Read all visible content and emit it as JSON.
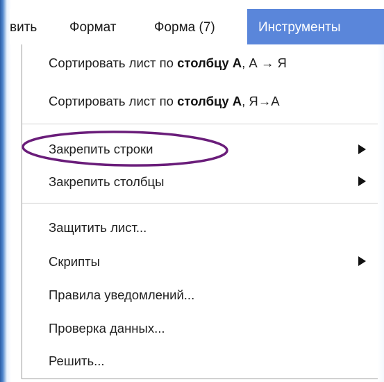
{
  "menubar": {
    "items": [
      {
        "label": "вить"
      },
      {
        "label": "Формат"
      },
      {
        "label": "Форма (7)"
      },
      {
        "label": "Инструменты"
      }
    ]
  },
  "menu": {
    "sort_az": {
      "prefix": "Сортировать лист по ",
      "bold": "столбцу А",
      "suffix": ", А → Я"
    },
    "sort_za": {
      "prefix": "Сортировать лист по ",
      "bold": "столбцу А",
      "suffix": ", Я→А"
    },
    "freeze_rows": "Закрепить строки",
    "freeze_columns": "Закрепить столбцы",
    "protect_sheet": "Защитить лист...",
    "scripts": "Скрипты",
    "notification_rules": "Правила уведомлений...",
    "data_validation": "Проверка данных...",
    "solve": "Решить..."
  },
  "highlight_color": "#6a1d7a",
  "active_menu_color": "#5a86da"
}
